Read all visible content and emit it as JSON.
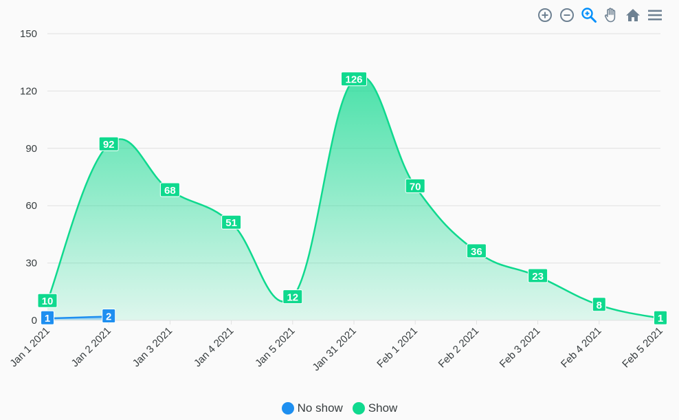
{
  "toolbar": {
    "icons": [
      "zoom-in-icon",
      "zoom-out-icon",
      "selection-zoom-icon",
      "pan-hand-icon",
      "home-reset-icon",
      "menu-icon"
    ],
    "colors": {
      "default": "#6e8192",
      "active": "#008ffb"
    }
  },
  "legend": {
    "items": [
      {
        "label": "No show",
        "color": "#1e8ff0"
      },
      {
        "label": "Show",
        "color": "#0fd98e"
      }
    ]
  },
  "chart_data": {
    "type": "area",
    "categories": [
      "Jan 1 2021",
      "Jan 2 2021",
      "Jan 3 2021",
      "Jan 4 2021",
      "Jan 5 2021",
      "Jan 31 2021",
      "Feb 1 2021",
      "Feb 2 2021",
      "Feb 3 2021",
      "Feb 4 2021",
      "Feb 5 2021"
    ],
    "yticks": [
      "0",
      "30",
      "60",
      "90",
      "120",
      "150"
    ],
    "ylim": [
      0,
      150
    ],
    "grid": true,
    "legend_position": "bottom",
    "series": [
      {
        "name": "No show",
        "color": "#1e8ff0",
        "values": [
          1,
          2
        ]
      },
      {
        "name": "Show",
        "color": "#0fd98e",
        "values": [
          10,
          92,
          68,
          51,
          12,
          126,
          70,
          36,
          23,
          8,
          1
        ]
      }
    ]
  }
}
